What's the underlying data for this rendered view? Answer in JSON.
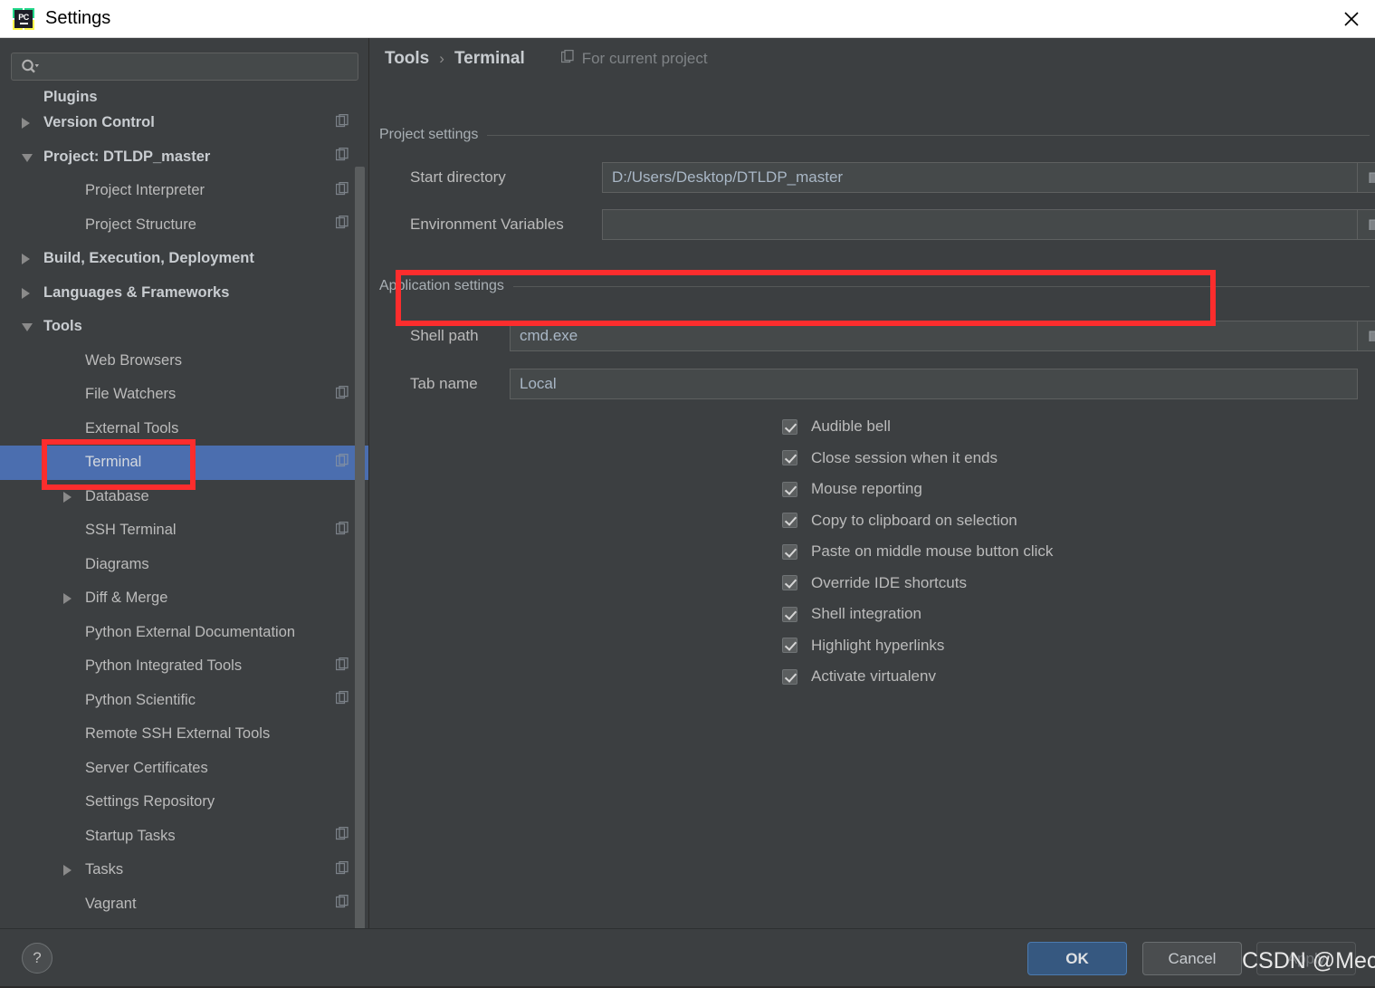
{
  "window": {
    "title": "Settings",
    "app_icon": "pycharm-icon",
    "close_icon": "close-icon"
  },
  "sidebar": {
    "search": {
      "placeholder": "",
      "value": "",
      "icon": "search-icon"
    },
    "items": [
      {
        "label": "Plugins",
        "indent": 26,
        "bold": true,
        "arrow": "none",
        "copy": false,
        "selected": false,
        "clipped": true
      },
      {
        "label": "Version Control",
        "indent": 26,
        "bold": true,
        "arrow": "right",
        "copy": true,
        "selected": false,
        "clipped": false
      },
      {
        "label": "Project: DTLDP_master",
        "indent": 26,
        "bold": true,
        "arrow": "down",
        "copy": true,
        "selected": false,
        "clipped": false
      },
      {
        "label": "Project Interpreter",
        "indent": 72,
        "bold": false,
        "arrow": "none",
        "copy": true,
        "selected": false,
        "clipped": false
      },
      {
        "label": "Project Structure",
        "indent": 72,
        "bold": false,
        "arrow": "none",
        "copy": true,
        "selected": false,
        "clipped": false
      },
      {
        "label": "Build, Execution, Deployment",
        "indent": 26,
        "bold": true,
        "arrow": "right",
        "copy": false,
        "selected": false,
        "clipped": false
      },
      {
        "label": "Languages & Frameworks",
        "indent": 26,
        "bold": true,
        "arrow": "right",
        "copy": false,
        "selected": false,
        "clipped": false
      },
      {
        "label": "Tools",
        "indent": 26,
        "bold": true,
        "arrow": "down",
        "copy": false,
        "selected": false,
        "clipped": false
      },
      {
        "label": "Web Browsers",
        "indent": 72,
        "bold": false,
        "arrow": "none",
        "copy": false,
        "selected": false,
        "clipped": false
      },
      {
        "label": "File Watchers",
        "indent": 72,
        "bold": false,
        "arrow": "none",
        "copy": true,
        "selected": false,
        "clipped": false
      },
      {
        "label": "External Tools",
        "indent": 72,
        "bold": false,
        "arrow": "none",
        "copy": false,
        "selected": false,
        "clipped": false
      },
      {
        "label": "Terminal",
        "indent": 72,
        "bold": false,
        "arrow": "none",
        "copy": true,
        "selected": true,
        "clipped": false
      },
      {
        "label": "Database",
        "indent": 72,
        "bold": false,
        "arrow": "right",
        "copy": false,
        "selected": false,
        "clipped": false
      },
      {
        "label": "SSH Terminal",
        "indent": 72,
        "bold": false,
        "arrow": "none",
        "copy": true,
        "selected": false,
        "clipped": false
      },
      {
        "label": "Diagrams",
        "indent": 72,
        "bold": false,
        "arrow": "none",
        "copy": false,
        "selected": false,
        "clipped": false
      },
      {
        "label": "Diff & Merge",
        "indent": 72,
        "bold": false,
        "arrow": "right",
        "copy": false,
        "selected": false,
        "clipped": false
      },
      {
        "label": "Python External Documentation",
        "indent": 72,
        "bold": false,
        "arrow": "none",
        "copy": false,
        "selected": false,
        "clipped": false
      },
      {
        "label": "Python Integrated Tools",
        "indent": 72,
        "bold": false,
        "arrow": "none",
        "copy": true,
        "selected": false,
        "clipped": false
      },
      {
        "label": "Python Scientific",
        "indent": 72,
        "bold": false,
        "arrow": "none",
        "copy": true,
        "selected": false,
        "clipped": false
      },
      {
        "label": "Remote SSH External Tools",
        "indent": 72,
        "bold": false,
        "arrow": "none",
        "copy": false,
        "selected": false,
        "clipped": false
      },
      {
        "label": "Server Certificates",
        "indent": 72,
        "bold": false,
        "arrow": "none",
        "copy": false,
        "selected": false,
        "clipped": false
      },
      {
        "label": "Settings Repository",
        "indent": 72,
        "bold": false,
        "arrow": "none",
        "copy": false,
        "selected": false,
        "clipped": false
      },
      {
        "label": "Startup Tasks",
        "indent": 72,
        "bold": false,
        "arrow": "none",
        "copy": true,
        "selected": false,
        "clipped": false
      },
      {
        "label": "Tasks",
        "indent": 72,
        "bold": false,
        "arrow": "right",
        "copy": true,
        "selected": false,
        "clipped": false
      },
      {
        "label": "Vagrant",
        "indent": 72,
        "bold": false,
        "arrow": "none",
        "copy": true,
        "selected": false,
        "clipped": false
      }
    ]
  },
  "content": {
    "breadcrumb": {
      "root": "Tools",
      "separator": "›",
      "leaf": "Terminal"
    },
    "for_current_project": {
      "label": "For current project",
      "icon": "copy-icon"
    },
    "project_settings": {
      "title": "Project settings",
      "start_directory": {
        "label": "Start directory",
        "value": "D:/Users/Desktop/DTLDP_master",
        "browse_icon": "folder-icon"
      },
      "environment_variables": {
        "label": "Environment Variables",
        "value": "",
        "browse_icon": "folder-icon"
      }
    },
    "application_settings": {
      "title": "Application settings",
      "shell_path": {
        "label": "Shell path",
        "value": "cmd.exe",
        "browse_icon": "folder-icon"
      },
      "tab_name": {
        "label": "Tab name",
        "value": "Local"
      },
      "checkboxes": [
        {
          "label": "Audible bell",
          "checked": true
        },
        {
          "label": "Close session when it ends",
          "checked": true
        },
        {
          "label": "Mouse reporting",
          "checked": true
        },
        {
          "label": "Copy to clipboard on selection",
          "checked": true
        },
        {
          "label": "Paste on middle mouse button click",
          "checked": true
        },
        {
          "label": "Override IDE shortcuts",
          "checked": true
        },
        {
          "label": "Shell integration",
          "checked": true
        },
        {
          "label": "Highlight hyperlinks",
          "checked": true
        },
        {
          "label": "Activate virtualenv",
          "checked": true
        }
      ]
    }
  },
  "footer": {
    "help_label": "?",
    "ok_label": "OK",
    "cancel_label": "Cancel",
    "apply_label": "Apply"
  },
  "watermark": {
    "text": "CSDN @Mecv"
  },
  "colors": {
    "window_bg": "#3c3f41",
    "selection_blue": "#4b6eaf",
    "annotation_red": "#fc2d2d",
    "ok_button": "#365880",
    "input_bg": "#45494a",
    "text": "#bbbbbb",
    "value_text": "#a9b7c6"
  }
}
